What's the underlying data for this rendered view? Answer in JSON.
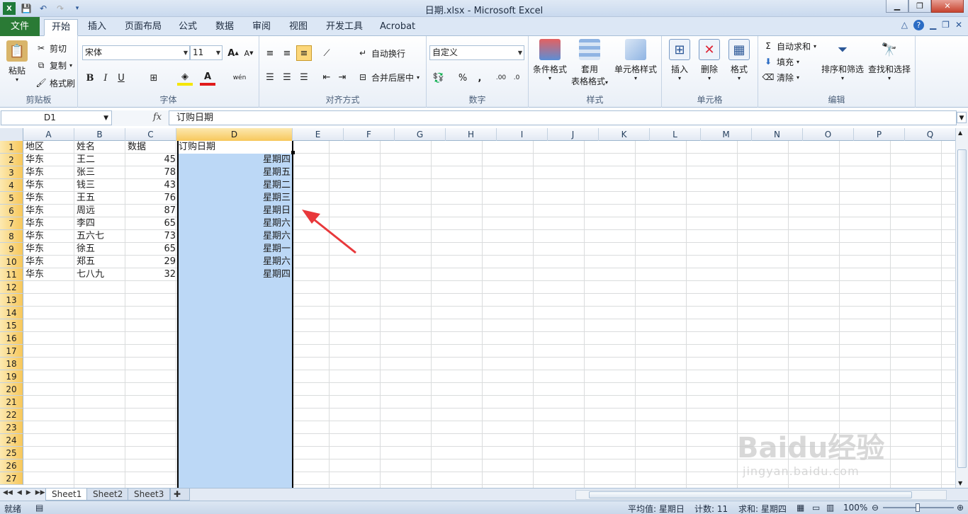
{
  "window": {
    "title": "日期.xlsx  -  Microsoft Excel"
  },
  "tabs": [
    "文件",
    "开始",
    "插入",
    "页面布局",
    "公式",
    "数据",
    "审阅",
    "视图",
    "开发工具",
    "Acrobat"
  ],
  "active_tab": "开始",
  "ribbon": {
    "clipboard": {
      "paste": "粘贴",
      "cut": "剪切",
      "copy": "复制",
      "format_painter": "格式刷",
      "label": "剪贴板"
    },
    "font": {
      "name": "宋体",
      "size": "11",
      "label": "字体",
      "bold": "B",
      "italic": "I",
      "underline": "U",
      "grow": "A",
      "shrink": "A",
      "font_color": "A",
      "phonetic": "wén"
    },
    "alignment": {
      "wrap": "自动换行",
      "merge": "合并后居中",
      "label": "对齐方式"
    },
    "number": {
      "format": "自定义",
      "percent": "%",
      "comma": ",",
      "label": "数字"
    },
    "styles": {
      "conditional": "条件格式",
      "table_1": "套用",
      "table_2": "表格格式",
      "cell_styles": "单元格样式",
      "label": "样式"
    },
    "cells": {
      "insert": "插入",
      "delete": "删除",
      "format": "格式",
      "label": "单元格"
    },
    "editing": {
      "autosum": "自动求和",
      "fill": "填充",
      "clear": "清除",
      "sort": "排序和筛选",
      "find": "查找和选择",
      "label": "编辑"
    }
  },
  "formula_bar": {
    "name_box": "D1",
    "fx": "fx",
    "content": "订购日期"
  },
  "columns": [
    "A",
    "B",
    "C",
    "D",
    "E",
    "F",
    "G",
    "H",
    "I",
    "J",
    "K",
    "L",
    "M",
    "N",
    "O",
    "P",
    "Q"
  ],
  "rows": [
    "1",
    "2",
    "3",
    "4",
    "5",
    "6",
    "7",
    "8",
    "9",
    "10",
    "11",
    "12",
    "13",
    "14",
    "15",
    "16",
    "17",
    "18",
    "19",
    "20",
    "21",
    "22",
    "23",
    "24",
    "25",
    "26",
    "27"
  ],
  "table": {
    "header": [
      "地区",
      "姓名",
      "数据",
      "订购日期"
    ],
    "data": [
      [
        "华东",
        "王二",
        "45",
        "星期四"
      ],
      [
        "华东",
        "张三",
        "78",
        "星期五"
      ],
      [
        "华东",
        "钱三",
        "43",
        "星期二"
      ],
      [
        "华东",
        "王五",
        "76",
        "星期三"
      ],
      [
        "华东",
        "周远",
        "87",
        "星期日"
      ],
      [
        "华东",
        "李四",
        "65",
        "星期六"
      ],
      [
        "华东",
        "五六七",
        "73",
        "星期六"
      ],
      [
        "华东",
        "徐五",
        "65",
        "星期一"
      ],
      [
        "华东",
        "郑五",
        "29",
        "星期六"
      ],
      [
        "华东",
        "七八九",
        "32",
        "星期四"
      ]
    ]
  },
  "sheets": [
    "Sheet1",
    "Sheet2",
    "Sheet3"
  ],
  "active_sheet": "Sheet1",
  "status": {
    "mode": "就绪",
    "average": "平均值: 星期日",
    "count": "计数: 11",
    "sum": "求和: 星期四",
    "zoom": "100%"
  },
  "watermark": {
    "main": "Baidu经验",
    "sub": "jingyan.baidu.com"
  },
  "colors": {
    "selection": "#bcd8f6",
    "file_tab": "#2a7a35",
    "arrow": "#e8383b"
  }
}
